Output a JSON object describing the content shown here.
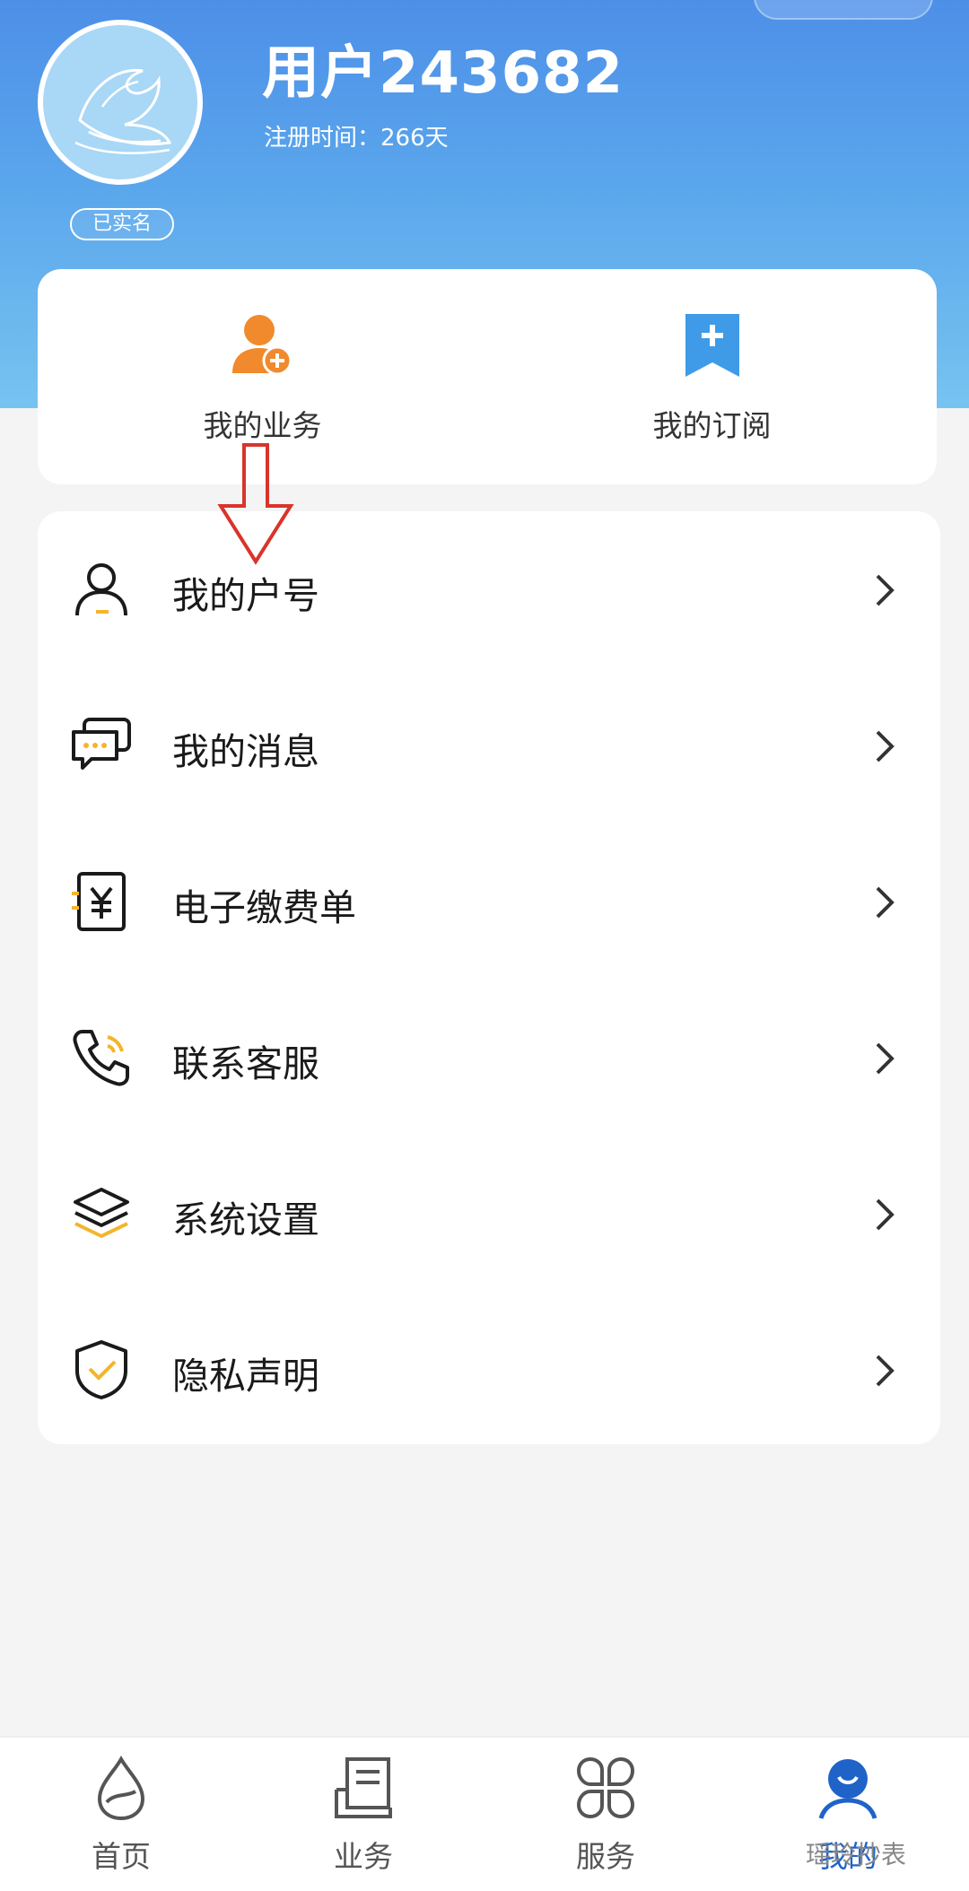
{
  "profile": {
    "username": "用户243682",
    "reg_label": "注册时间：",
    "reg_value": "266天",
    "verified_badge": "已实名"
  },
  "quick_actions": [
    {
      "label": "我的业务",
      "icon": "user-add-icon"
    },
    {
      "label": "我的订阅",
      "icon": "bookmark-plus-icon"
    }
  ],
  "menu": [
    {
      "label": "我的户号",
      "icon": "user-outline-icon"
    },
    {
      "label": "我的消息",
      "icon": "message-bubbles-icon"
    },
    {
      "label": "电子缴费单",
      "icon": "yuan-bill-icon"
    },
    {
      "label": "联系客服",
      "icon": "phone-icon"
    },
    {
      "label": "系统设置",
      "icon": "layers-icon"
    },
    {
      "label": "隐私声明",
      "icon": "shield-check-icon"
    }
  ],
  "bottom_nav": [
    {
      "label": "首页",
      "icon": "water-drop-icon"
    },
    {
      "label": "业务",
      "icon": "document-icon"
    },
    {
      "label": "服务",
      "icon": "grid-petals-icon"
    },
    {
      "label": "我的",
      "icon": "profile-icon",
      "active": true
    }
  ],
  "watermark": "瑶玲抄表",
  "colors": {
    "header_top": "#4d8fe8",
    "header_bottom": "#77c3f0",
    "accent_orange": "#f08a2c",
    "accent_blue": "#3f9be8",
    "accent_yellow": "#f3b52a",
    "nav_active": "#1f63c8",
    "annotation_red": "#d9342b"
  }
}
